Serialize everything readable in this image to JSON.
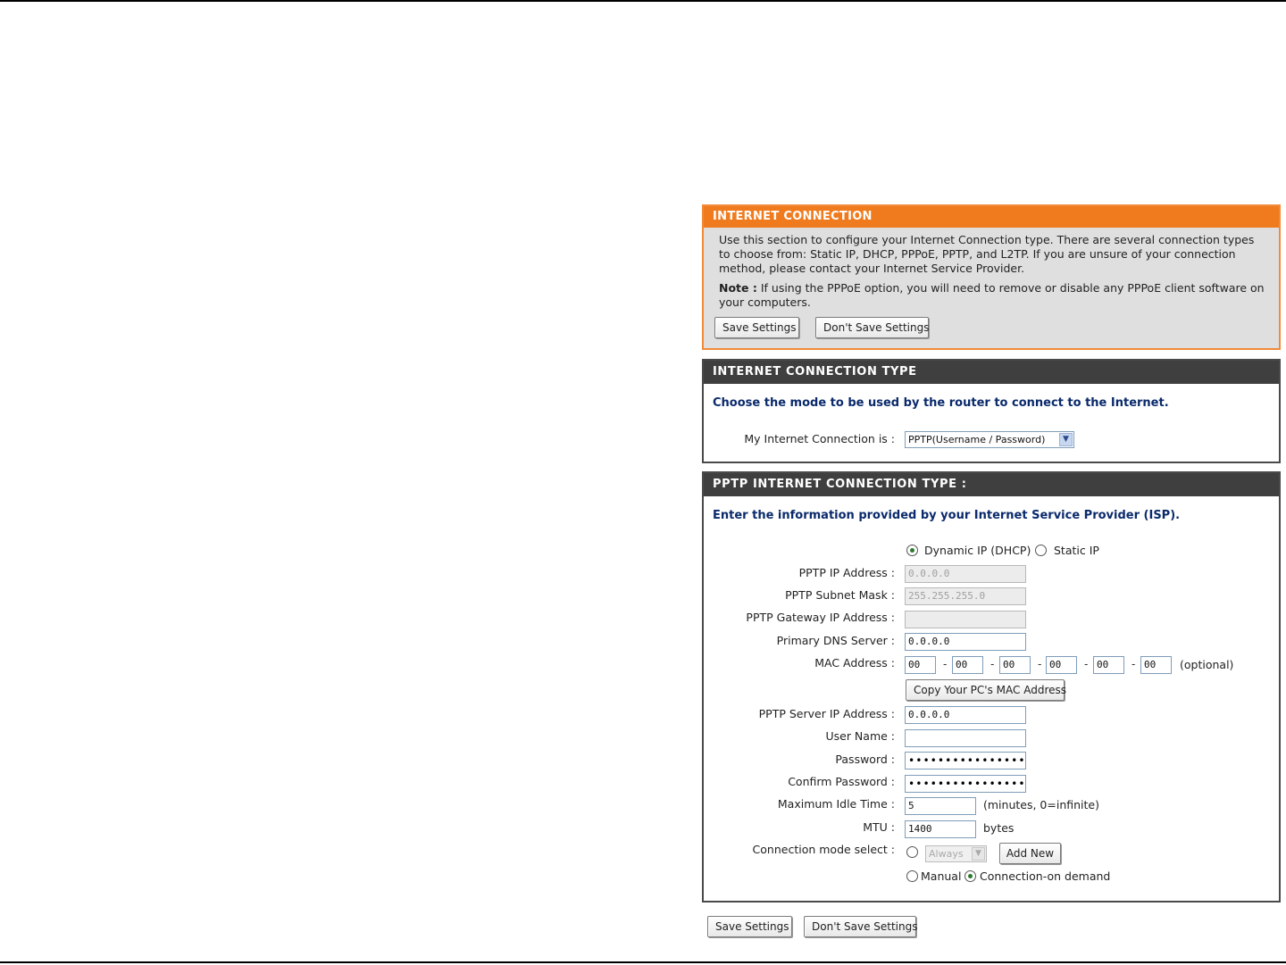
{
  "intro": {
    "title": "INTERNET CONNECTION",
    "description_line1": "Use this section to configure your Internet Connection type. There are several connection types",
    "description_line2": "to choose from: Static IP, DHCP, PPPoE, PPTP, and L2TP. If you are unsure of your connection",
    "description_line3": "method, please contact your Internet Service Provider.",
    "note_label": "Note :",
    "note_line1": "If using the PPPoE option, you will need to remove or disable any PPPoE client software on",
    "note_line2": "your computers.",
    "save_label": "Save Settings",
    "dont_save_label": "Don't Save Settings"
  },
  "connection_type": {
    "title": "INTERNET CONNECTION TYPE",
    "lead": "Choose the mode to be used by the router to connect to the Internet.",
    "label": "My Internet Connection is :",
    "selected": "PPTP(Username / Password)"
  },
  "pptp": {
    "title": "PPTP INTERNET CONNECTION TYPE :",
    "lead": "Enter the information provided by your Internet Service Provider (ISP).",
    "mode_dynamic": "Dynamic IP (DHCP)",
    "mode_static": "Static IP",
    "ip_label": "PPTP IP Address :",
    "ip_value": "0.0.0.0",
    "subnet_label": "PPTP Subnet Mask :",
    "subnet_value": "255.255.255.0",
    "gateway_label": "PPTP Gateway IP Address :",
    "gateway_value": "",
    "dns_label": "Primary DNS Server :",
    "dns_value": "0.0.0.0",
    "mac_label": "MAC Address :",
    "mac": [
      "00",
      "00",
      "00",
      "00",
      "00",
      "00"
    ],
    "mac_optional": "(optional)",
    "copy_mac_label": "Copy Your PC's MAC Address",
    "server_label": "PPTP Server IP Address :",
    "server_value": "0.0.0.0",
    "username_label": "User Name :",
    "username_value": "",
    "password_label": "Password :",
    "password_value": "•••••••••••••••••",
    "confirm_label": "Confirm Password :",
    "confirm_value": "•••••••••••••••••",
    "idle_label": "Maximum Idle Time :",
    "idle_value": "5",
    "idle_hint": "(minutes, 0=infinite)",
    "mtu_label": "MTU :",
    "mtu_value": "1400",
    "mtu_unit": "bytes",
    "conn_mode_label": "Connection mode select :",
    "schedule_value": "Always",
    "add_new_label": "Add New",
    "manual_label": "Manual",
    "on_demand_label": "Connection-on demand"
  },
  "footer": {
    "save_label": "Save Settings",
    "dont_save_label": "Don't Save Settings"
  }
}
